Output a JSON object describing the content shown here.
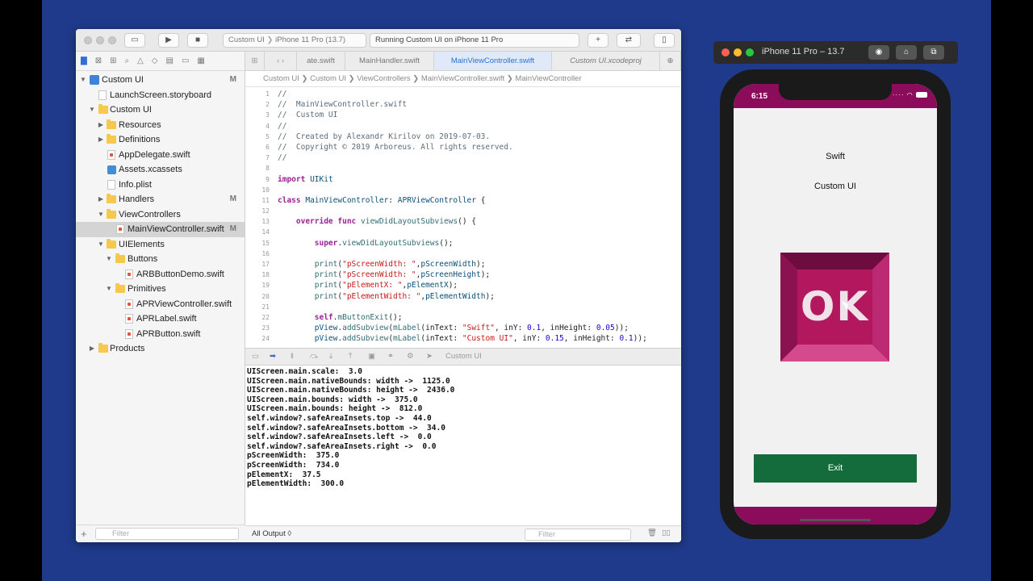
{
  "xcode": {
    "toolbar": {
      "scheme_target": "Custom UI",
      "scheme_device": "iPhone 11 Pro (13.7)",
      "status": "Running Custom UI on iPhone 11 Pro"
    },
    "navigator": {
      "items": [
        {
          "label": "Custom UI",
          "flag": "M"
        },
        {
          "label": "LaunchScreen.storyboard",
          "flag": ""
        },
        {
          "label": "Custom UI",
          "flag": ""
        },
        {
          "label": "Resources",
          "flag": ""
        },
        {
          "label": "Definitions",
          "flag": ""
        },
        {
          "label": "AppDelegate.swift",
          "flag": ""
        },
        {
          "label": "Assets.xcassets",
          "flag": ""
        },
        {
          "label": "Info.plist",
          "flag": ""
        },
        {
          "label": "Handlers",
          "flag": "M"
        },
        {
          "label": "ViewControllers",
          "flag": ""
        },
        {
          "label": "MainViewController.swift",
          "flag": "M"
        },
        {
          "label": "UIElements",
          "flag": ""
        },
        {
          "label": "Buttons",
          "flag": ""
        },
        {
          "label": "ARBButtonDemo.swift",
          "flag": ""
        },
        {
          "label": "Primitives",
          "flag": ""
        },
        {
          "label": "APRViewController.swift",
          "flag": ""
        },
        {
          "label": "APRLabel.swift",
          "flag": ""
        },
        {
          "label": "APRButton.swift",
          "flag": ""
        },
        {
          "label": "Products",
          "flag": ""
        }
      ],
      "filter_placeholder": "Filter"
    },
    "tabs": [
      "ate.swift",
      "MainHandler.swift",
      "MainViewController.swift",
      "Custom UI.xcodeproj"
    ],
    "jumpbar": [
      "Custom UI",
      "Custom UI",
      "ViewControllers",
      "MainViewController.swift",
      "MainViewController"
    ],
    "code_lines": [
      {
        "n": "1",
        "t": "//"
      },
      {
        "n": "2",
        "t": "//  MainViewController.swift"
      },
      {
        "n": "3",
        "t": "//  Custom UI"
      },
      {
        "n": "4",
        "t": "//"
      },
      {
        "n": "5",
        "t": "//  Created by Alexandr Kirilov on 2019-07-03."
      },
      {
        "n": "6",
        "t": "//  Copyright © 2019 Arboreus. All rights reserved."
      },
      {
        "n": "7",
        "t": "//"
      },
      {
        "n": "8",
        "t": ""
      },
      {
        "n": "9",
        "t": "import UIKit"
      },
      {
        "n": "10",
        "t": ""
      },
      {
        "n": "11",
        "t": "class MainViewController: APRViewController {"
      },
      {
        "n": "12",
        "t": ""
      },
      {
        "n": "13",
        "t": "    override func viewDidLayoutSubviews() {"
      },
      {
        "n": "14",
        "t": ""
      },
      {
        "n": "15",
        "t": "        super.viewDidLayoutSubviews();"
      },
      {
        "n": "16",
        "t": ""
      },
      {
        "n": "17",
        "t": "        print(\"pScreenWidth: \",pScreenWidth);"
      },
      {
        "n": "18",
        "t": "        print(\"pScreenWidth: \",pScreenHeight);"
      },
      {
        "n": "19",
        "t": "        print(\"pElementX: \",pElementX);"
      },
      {
        "n": "20",
        "t": "        print(\"pElementWidth: \",pElementWidth);"
      },
      {
        "n": "21",
        "t": ""
      },
      {
        "n": "22",
        "t": "        self.mButtonExit();"
      },
      {
        "n": "23",
        "t": "        pView.addSubview(mLabel(inText: \"Swift\", inY: 0.1, inHeight: 0.05));"
      },
      {
        "n": "24",
        "t": "        pView.addSubview(mLabel(inText: \"Custom UI\", inY: 0.15, inHeight: 0.1));"
      }
    ],
    "debug_target": "Custom UI",
    "console_lines": [
      "UIScreen.main.scale:  3.0",
      "UIScreen.main.nativeBounds: width ->  1125.0",
      "UIScreen.main.nativeBounds: height ->  2436.0",
      "UIScreen.main.bounds: width ->  375.0",
      "UIScreen.main.bounds: height ->  812.0",
      "self.window?.safeAreaInsets.top ->  44.0",
      "self.window?.safeAreaInsets.bottom ->  34.0",
      "self.window?.safeAreaInsets.left ->  0.0",
      "self.window?.safeAreaInsets.right ->  0.0",
      "pScreenWidth:  375.0",
      "pScreenWidth:  734.0",
      "pElementX:  37.5",
      "pElementWidth:  300.0"
    ],
    "output_selector": "All Output ◊",
    "console_filter_placeholder": "Filter"
  },
  "simulator": {
    "title": "iPhone 11 Pro – 13.7",
    "time": "6:15",
    "label_swift": "Swift",
    "label_custom": "Custom UI",
    "ok_label": "OK",
    "exit_label": "Exit",
    "colors": {
      "bar": "#8b0c5b",
      "ok_button": "#a3175f",
      "exit_button": "#146c3c",
      "background": "#1f3a8a"
    }
  }
}
